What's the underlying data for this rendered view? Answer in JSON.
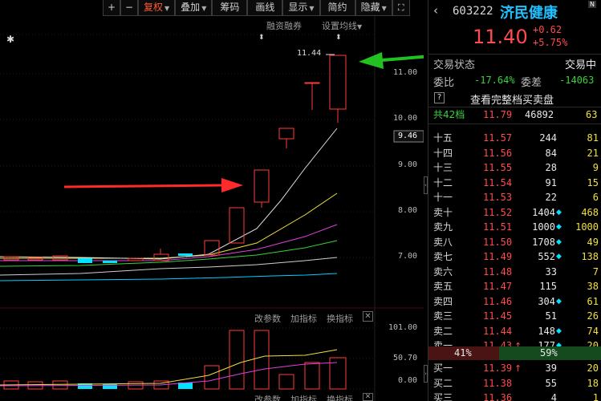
{
  "toolbar": {
    "items": [
      "+",
      "−",
      "复权",
      "叠加",
      "筹码",
      "画线",
      "显示",
      "简约",
      "隐藏"
    ],
    "fullscreen_icon": "expand-icon"
  },
  "chart": {
    "right_top_links": [
      "融资融券",
      "设置均线"
    ],
    "price_ticks": [
      "11.00",
      "10.00",
      "9.00",
      "8.00",
      "7.00"
    ],
    "current_price_tag": "9.46",
    "high_label": "11.44",
    "sub_buttons_1": [
      "改参数",
      "加指标",
      "换指标"
    ],
    "sub_buttons_2": [
      "改参数",
      "加指标",
      "换指标"
    ],
    "vol_ticks": [
      "101.00",
      "50.70",
      "0.00"
    ],
    "colors": {
      "up": "#ff3b3b",
      "down": "#00e5ff",
      "ma5": "#e0e0e0",
      "ma10": "#f0e040",
      "ma20": "#e040e0",
      "ma30": "#38d23a",
      "ma60": "#cfcfcf",
      "ma120": "#00cfff"
    }
  },
  "quote": {
    "code": "603222",
    "name": "济民健康",
    "price": "11.40",
    "change": "+0.62",
    "change_pct": "+5.75%",
    "status_label": "交易状态",
    "status_value": "交易中",
    "wb_label": "委比",
    "wb_value": "-17.64%",
    "wc_label": "委差",
    "wc_value": "-14063",
    "full_book_link": "查看完整档买卖盘",
    "depth_label": "共42档",
    "depth_price": "11.79",
    "depth_vol": "46892",
    "depth_count": "63",
    "asks": [
      {
        "label": "十五",
        "price": "11.57",
        "vol": "244",
        "cnt": "81",
        "dot": false
      },
      {
        "label": "十四",
        "price": "11.56",
        "vol": "84",
        "cnt": "21",
        "dot": false
      },
      {
        "label": "十三",
        "price": "11.55",
        "vol": "28",
        "cnt": "9",
        "dot": false
      },
      {
        "label": "十二",
        "price": "11.54",
        "vol": "91",
        "cnt": "15",
        "dot": false
      },
      {
        "label": "十一",
        "price": "11.53",
        "vol": "22",
        "cnt": "6",
        "dot": false
      },
      {
        "label": "卖十",
        "price": "11.52",
        "vol": "1404",
        "cnt": "468",
        "dot": true
      },
      {
        "label": "卖九",
        "price": "11.51",
        "vol": "1000",
        "cnt": "1000",
        "dot": true
      },
      {
        "label": "卖八",
        "price": "11.50",
        "vol": "1708",
        "cnt": "49",
        "dot": true
      },
      {
        "label": "卖七",
        "price": "11.49",
        "vol": "552",
        "cnt": "138",
        "dot": true
      },
      {
        "label": "卖六",
        "price": "11.48",
        "vol": "33",
        "cnt": "7",
        "dot": false
      },
      {
        "label": "卖五",
        "price": "11.47",
        "vol": "115",
        "cnt": "38",
        "dot": false
      },
      {
        "label": "卖四",
        "price": "11.46",
        "vol": "304",
        "cnt": "61",
        "dot": true
      },
      {
        "label": "卖三",
        "price": "11.45",
        "vol": "51",
        "cnt": "26",
        "dot": false
      },
      {
        "label": "卖二",
        "price": "11.44",
        "vol": "148",
        "cnt": "74",
        "dot": true
      },
      {
        "label": "卖一",
        "price": "11.43",
        "vol": "177",
        "cnt": "20",
        "dot": true,
        "arrow": "↑"
      }
    ],
    "ratio_sell": "41%",
    "ratio_buy": "59%",
    "bids": [
      {
        "label": "买一",
        "price": "11.39",
        "vol": "39",
        "cnt": "20",
        "arrow": "↑"
      },
      {
        "label": "买二",
        "price": "11.38",
        "vol": "55",
        "cnt": "18"
      },
      {
        "label": "买三",
        "price": "11.36",
        "vol": "4",
        "cnt": "1"
      }
    ]
  }
}
